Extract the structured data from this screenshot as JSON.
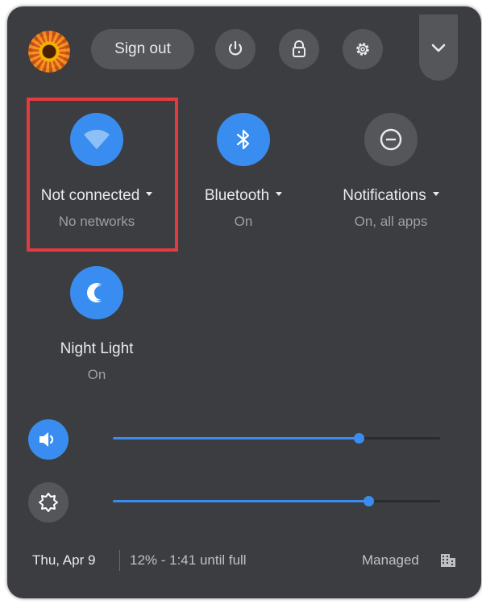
{
  "header": {
    "sign_out_label": "Sign out",
    "icons": [
      "power-icon",
      "lock-icon",
      "settings-gear-icon",
      "chevron-down-icon"
    ]
  },
  "tiles": [
    {
      "label": "Not connected",
      "status": "No networks",
      "icon": "wifi-icon",
      "state": "on",
      "has_menu": true
    },
    {
      "label": "Bluetooth",
      "status": "On",
      "icon": "bluetooth-icon",
      "state": "on",
      "has_menu": true
    },
    {
      "label": "Notifications",
      "status": "On, all apps",
      "icon": "do-not-disturb-icon",
      "state": "off",
      "has_menu": true
    },
    {
      "label": "Night Light",
      "status": "On",
      "icon": "moon-icon",
      "state": "on",
      "has_menu": false
    }
  ],
  "sliders": {
    "volume": {
      "icon": "speaker-icon",
      "level_percent": 75
    },
    "brightness": {
      "icon": "brightness-icon",
      "level_percent": 78
    }
  },
  "footer": {
    "date": "Thu, Apr 9",
    "battery": "12% - 1:41 until full",
    "managed": "Managed",
    "managed_icon": "building-icon"
  },
  "colors": {
    "panel_bg": "#3c3d41",
    "accent": "#3a8df0",
    "highlight_border": "#e53b3f"
  }
}
